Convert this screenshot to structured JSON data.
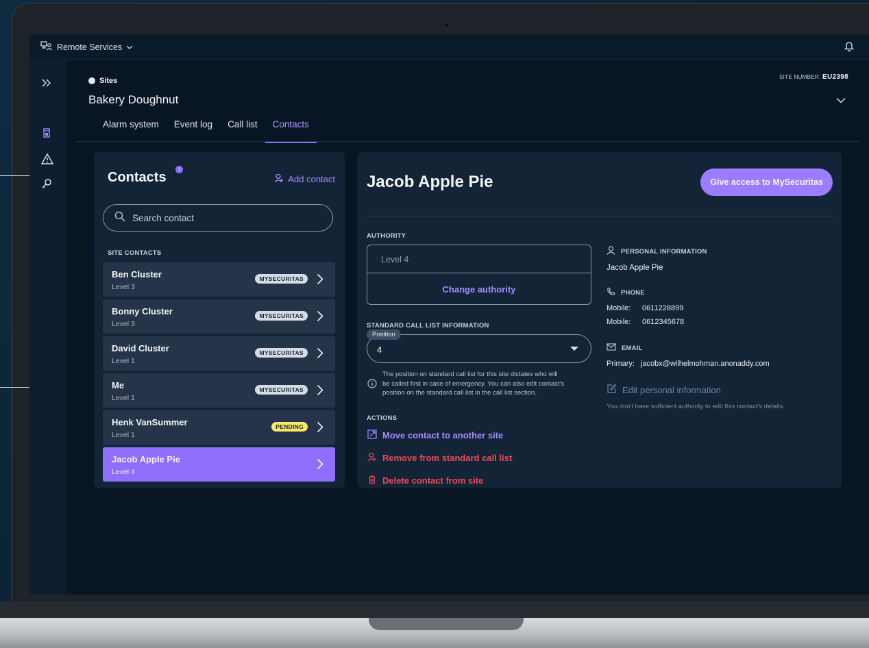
{
  "topbar": {
    "service": "Remote Services"
  },
  "header": {
    "breadcrumb": "Sites",
    "site_name": "Bakery Doughnut",
    "site_number_label": "SITE NUMBER:",
    "site_number": "EU2398"
  },
  "tabs": [
    {
      "label": "Alarm system"
    },
    {
      "label": "Event log"
    },
    {
      "label": "Call list"
    },
    {
      "label": "Contacts",
      "active": true
    }
  ],
  "contacts_panel": {
    "title": "Contacts",
    "info_badge": "i",
    "add_label": "Add contact",
    "search_placeholder": "Search contact",
    "section_label": "SITE CONTACTS",
    "items": [
      {
        "name": "Ben Cluster",
        "level": "Level 3",
        "badge": "MYSECURITAS"
      },
      {
        "name": "Bonny Cluster",
        "level": "Level 3",
        "badge": "MYSECURITAS"
      },
      {
        "name": "David Cluster",
        "level": "Level 1",
        "badge": "MYSECURITAS"
      },
      {
        "name": "Me",
        "level": "Level 1",
        "badge": "MYSECURITAS"
      },
      {
        "name": "Henk VanSummer",
        "level": "Level 1",
        "badge": "PENDING"
      },
      {
        "name": "Jacob Apple Pie",
        "level": "Level 4",
        "badge": "",
        "selected": true
      }
    ]
  },
  "detail": {
    "name": "Jacob Apple Pie",
    "give_access_label": "Give access to MySecuritas",
    "authority_label": "AUTHORITY",
    "authority_value": "Level 4",
    "change_authority_label": "Change authority",
    "call_list_label": "STANDARD CALL LIST INFORMATION",
    "position_label": "Position",
    "position_value": "4",
    "note_line1": "The position on standard call list for this site dictates who will",
    "note_line2": "be called first in case of emergency. You can also edit contact's",
    "note_line3": "position on the standard call list in the call list section.",
    "actions_label": "ACTIONS",
    "actions": {
      "move": "Move contact to another site",
      "remove": "Remove from standard call list",
      "delete": "Delete contact from site"
    },
    "personal_label": "PERSONAL INFORMATION",
    "personal_name": "Jacob Apple Pie",
    "phone_label": "PHONE",
    "phones": [
      {
        "type": "Mobile:",
        "number": "0611228899"
      },
      {
        "type": "Mobile:",
        "number": "0612345678"
      }
    ],
    "email_label": "EMAIL",
    "email": {
      "type": "Primary:",
      "address": "jacobx@wilhelmohman.anonaddy.com"
    },
    "edit_label": "Edit personal information",
    "edit_warning": "You don't have sufficient authority to edit this contact's details."
  },
  "colors": {
    "accent": "#9b7dff",
    "danger": "#ef4a57",
    "pending_badge": "#f5e86d",
    "panel_bg": "#132436"
  }
}
